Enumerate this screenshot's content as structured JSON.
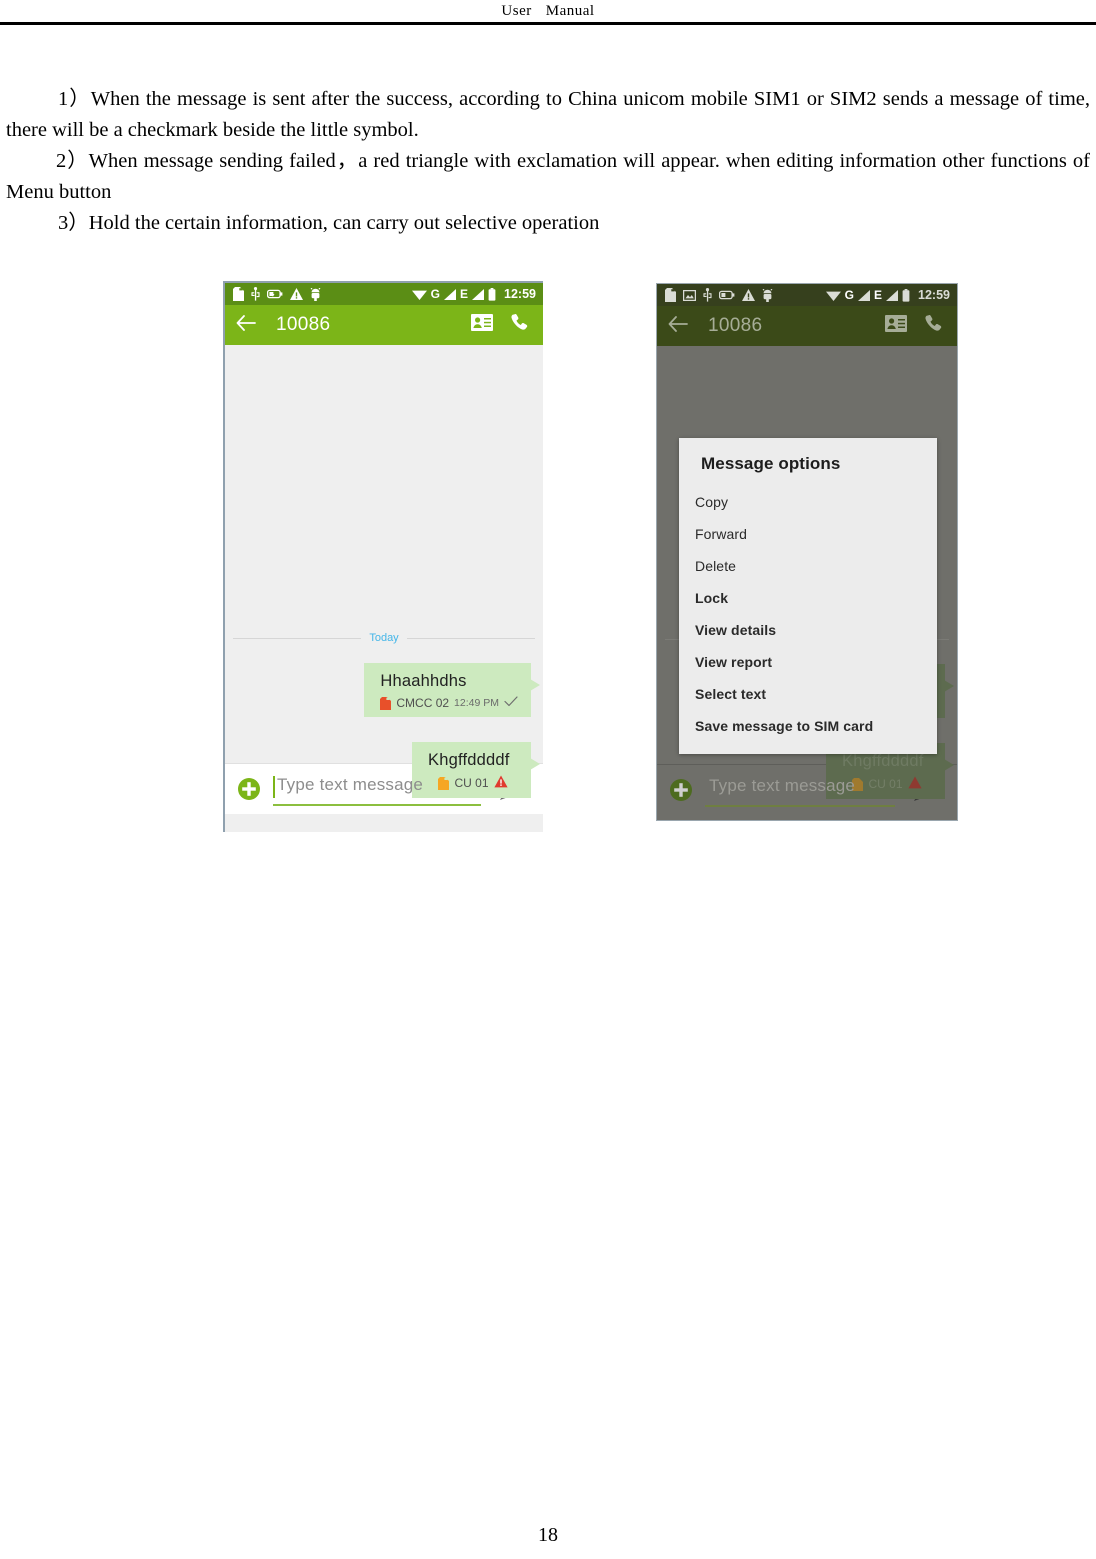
{
  "document": {
    "header_left": "User",
    "header_right": "Manual",
    "page_number": "18",
    "paragraphs": [
      "1）When the message is sent after the success, according to China unicom mobile SIM1 or SIM2 sends a message of time, there will be a checkmark beside the little symbol.",
      "2）When message sending failed，a red triangle with exclamation will appear. when editing information other functions of Menu button",
      "3）Hold the certain information, can carry out selective operation"
    ]
  },
  "colors": {
    "status_bar_green": "#5b8e15",
    "action_bar_green": "#7cb518",
    "status_bar_dim": "#36401d",
    "action_bar_dim": "#3b4a18",
    "bubble_green": "#cdeabf",
    "bubble_dim": "#5d6b4f",
    "convo_background": "#efefef",
    "scrim": "#6f6f6a",
    "today_blue": "#45b6e8",
    "sim1_chip_red": "#e8502a",
    "sim2_chip_orange": "#f6a623",
    "error_red": "#e03b2f",
    "dialog_background": "#ececec",
    "underline_green": "#8cbf3f"
  },
  "screen_a": {
    "status_bar": {
      "left_icons": [
        "sd-card-icon",
        "usb-icon",
        "battery-charging-icon",
        "warning-triangle-icon",
        "android-debug-icon"
      ],
      "right_icons": [
        "wifi-icon",
        "gprs-signal-icon",
        "edge-signal-icon",
        "battery-icon"
      ],
      "gprs_label": "G",
      "edge_label": "E",
      "clock": "12:59"
    },
    "action_bar": {
      "back_icon": "back-arrow-icon",
      "title": "10086",
      "contact_icon": "contact-card-icon",
      "call_icon": "phone-call-icon"
    },
    "day_separator": "Today",
    "messages": [
      {
        "text": "Hhaahhdhs",
        "sim_label": "CMCC 02",
        "time": "12:49 PM",
        "status_icon": "checkmark-icon",
        "chip": "sim1-red-chip"
      },
      {
        "text": "Khgffddddf",
        "sim_label": "CU 01",
        "time": "",
        "status_icon": "error-triangle-icon",
        "chip": "sim2-orange-chip"
      }
    ],
    "compose": {
      "add_icon": "add-attachment-icon",
      "placeholder": "Type text message",
      "send_icon": "send-arrow-icon"
    }
  },
  "screen_b": {
    "status_bar": {
      "left_icons": [
        "sd-card-icon",
        "screenshot-icon",
        "usb-icon",
        "battery-charging-icon",
        "warning-triangle-icon",
        "android-debug-icon"
      ],
      "right_icons": [
        "wifi-icon",
        "gprs-signal-icon",
        "edge-signal-icon",
        "battery-icon"
      ],
      "gprs_label": "G",
      "edge_label": "E",
      "clock": "12:59"
    },
    "action_bar": {
      "back_icon": "back-arrow-icon",
      "title": "10086",
      "contact_icon": "contact-card-icon",
      "call_icon": "phone-call-icon"
    },
    "dialog": {
      "title": "Message options",
      "items": [
        "Copy",
        "Forward",
        "Delete",
        "Lock",
        "View details",
        "View report",
        "Select text",
        "Save message to SIM card"
      ]
    },
    "compose": {
      "add_icon": "add-attachment-icon",
      "placeholder": "Type text message",
      "send_icon": "send-arrow-icon"
    }
  }
}
